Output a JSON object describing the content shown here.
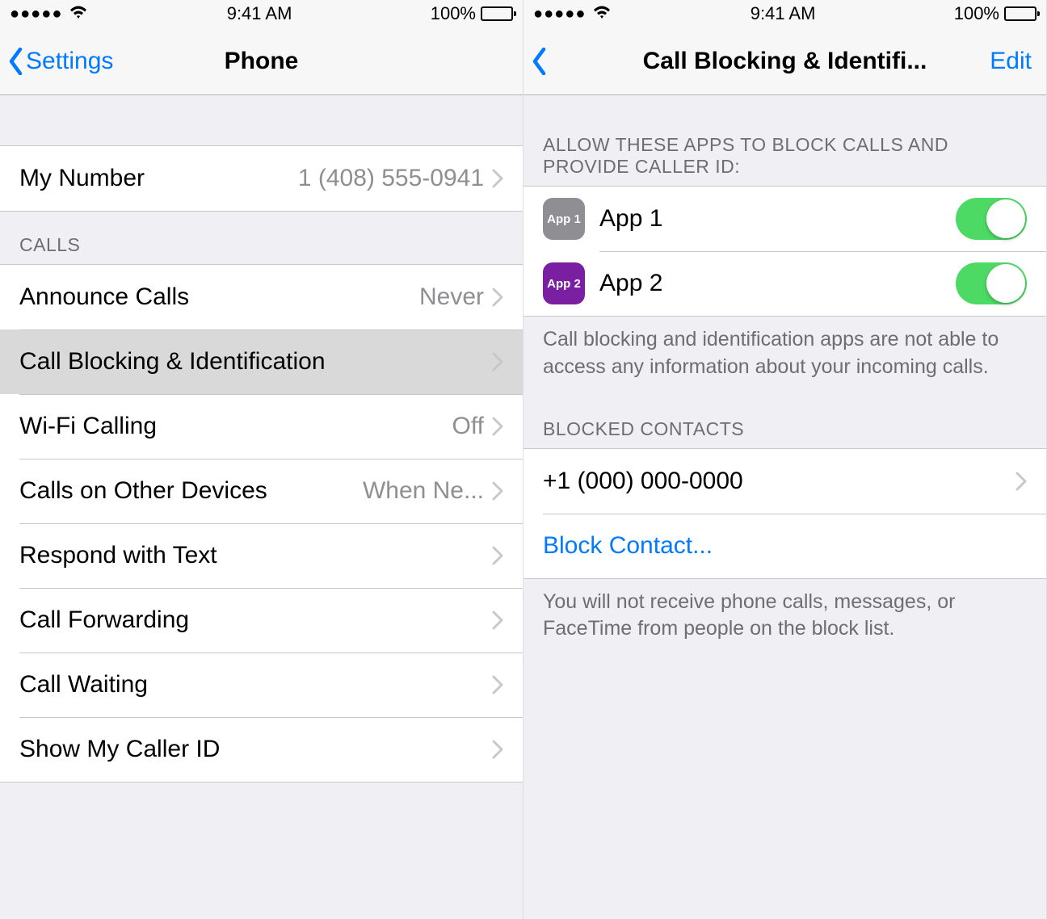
{
  "status": {
    "time": "9:41 AM",
    "battery": "100%"
  },
  "left": {
    "nav": {
      "back": "Settings",
      "title": "Phone"
    },
    "my_number": {
      "label": "My Number",
      "value": "1 (408) 555-0941"
    },
    "section_calls": "Calls",
    "rows": {
      "announce": {
        "label": "Announce Calls",
        "value": "Never"
      },
      "blocking": {
        "label": "Call Blocking & Identification"
      },
      "wifi": {
        "label": "Wi-Fi Calling",
        "value": "Off"
      },
      "other": {
        "label": "Calls on Other Devices",
        "value": "When Ne..."
      },
      "respond": {
        "label": "Respond with Text"
      },
      "forwarding": {
        "label": "Call Forwarding"
      },
      "waiting": {
        "label": "Call Waiting"
      },
      "callerid": {
        "label": "Show My Caller ID"
      }
    }
  },
  "right": {
    "nav": {
      "title": "Call Blocking & Identifi...",
      "edit": "Edit"
    },
    "section_allow": "Allow these apps to block calls and provide caller ID:",
    "apps": [
      {
        "name": "App 1",
        "icon_label": "App 1",
        "color": "#8e8e93",
        "on": true
      },
      {
        "name": "App 2",
        "icon_label": "App 2",
        "color": "#7b1fa2",
        "on": true
      }
    ],
    "footer_apps": "Call blocking and identification apps are not able to access any information about your incoming calls.",
    "section_blocked": "Blocked Contacts",
    "blocked_number": "+1 (000) 000-0000",
    "block_contact": "Block Contact...",
    "footer_blocked": "You will not receive phone calls, messages, or FaceTime from people on the block list."
  }
}
